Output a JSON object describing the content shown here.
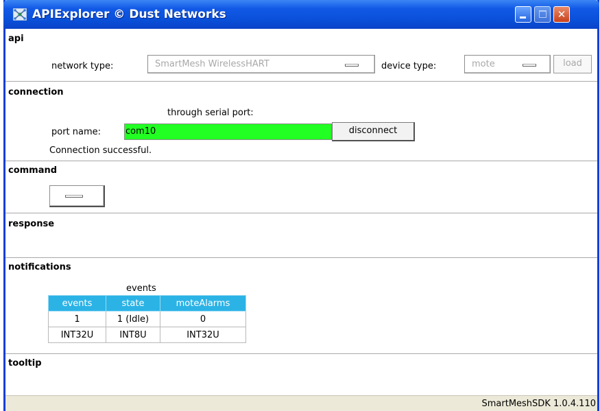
{
  "window": {
    "title": "APIExplorer © Dust Networks",
    "icon": "network-app-icon",
    "controls": {
      "minimize": "minimize-icon",
      "maximize": "maximize-icon",
      "close": "✕"
    }
  },
  "api": {
    "title": "api",
    "network_type_label": "network type:",
    "network_type_value": "SmartMesh WirelessHART",
    "device_type_label": "device type:",
    "device_type_value": "mote",
    "load_label": "load"
  },
  "connection": {
    "title": "connection",
    "through_label": "through serial port:",
    "port_name_label": "port name:",
    "port_name_value": "com10",
    "disconnect_label": "disconnect",
    "status_text": "Connection successful."
  },
  "command": {
    "title": "command"
  },
  "response": {
    "title": "response"
  },
  "notifications": {
    "title": "notifications",
    "table_caption": "events",
    "columns": [
      "events",
      "state",
      "moteAlarms"
    ],
    "rows": [
      [
        "1",
        "1 (Idle)",
        "0"
      ],
      [
        "INT32U",
        "INT8U",
        "INT32U"
      ]
    ],
    "header_color": "#2bb3e6"
  },
  "tooltip": {
    "title": "tooltip"
  },
  "status_bar": {
    "version": "SmartMeshSDK 1.0.4.110"
  },
  "colors": {
    "title_bar": "#0a4fd8",
    "port_field_bg": "#22ff22"
  }
}
